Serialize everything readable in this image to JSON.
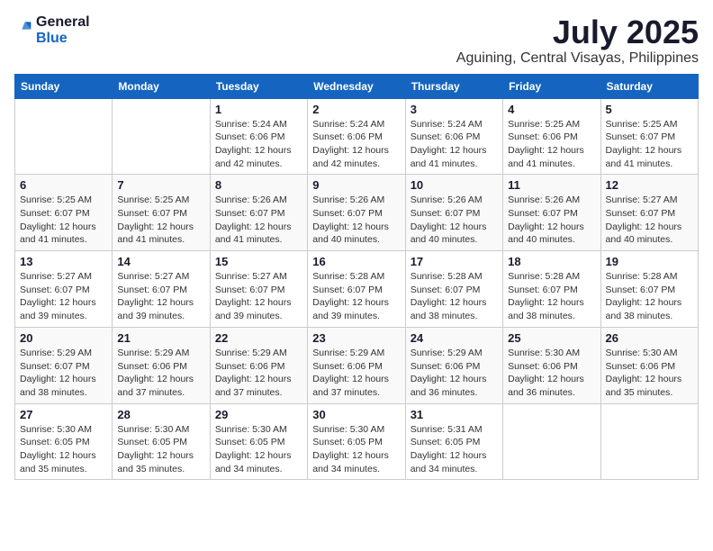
{
  "header": {
    "logo_general": "General",
    "logo_blue": "Blue",
    "month": "July 2025",
    "location": "Aguining, Central Visayas, Philippines"
  },
  "days_of_week": [
    "Sunday",
    "Monday",
    "Tuesday",
    "Wednesday",
    "Thursday",
    "Friday",
    "Saturday"
  ],
  "weeks": [
    [
      {
        "day": "",
        "info": ""
      },
      {
        "day": "",
        "info": ""
      },
      {
        "day": "1",
        "info": "Sunrise: 5:24 AM\nSunset: 6:06 PM\nDaylight: 12 hours and 42 minutes."
      },
      {
        "day": "2",
        "info": "Sunrise: 5:24 AM\nSunset: 6:06 PM\nDaylight: 12 hours and 42 minutes."
      },
      {
        "day": "3",
        "info": "Sunrise: 5:24 AM\nSunset: 6:06 PM\nDaylight: 12 hours and 41 minutes."
      },
      {
        "day": "4",
        "info": "Sunrise: 5:25 AM\nSunset: 6:06 PM\nDaylight: 12 hours and 41 minutes."
      },
      {
        "day": "5",
        "info": "Sunrise: 5:25 AM\nSunset: 6:07 PM\nDaylight: 12 hours and 41 minutes."
      }
    ],
    [
      {
        "day": "6",
        "info": "Sunrise: 5:25 AM\nSunset: 6:07 PM\nDaylight: 12 hours and 41 minutes."
      },
      {
        "day": "7",
        "info": "Sunrise: 5:25 AM\nSunset: 6:07 PM\nDaylight: 12 hours and 41 minutes."
      },
      {
        "day": "8",
        "info": "Sunrise: 5:26 AM\nSunset: 6:07 PM\nDaylight: 12 hours and 41 minutes."
      },
      {
        "day": "9",
        "info": "Sunrise: 5:26 AM\nSunset: 6:07 PM\nDaylight: 12 hours and 40 minutes."
      },
      {
        "day": "10",
        "info": "Sunrise: 5:26 AM\nSunset: 6:07 PM\nDaylight: 12 hours and 40 minutes."
      },
      {
        "day": "11",
        "info": "Sunrise: 5:26 AM\nSunset: 6:07 PM\nDaylight: 12 hours and 40 minutes."
      },
      {
        "day": "12",
        "info": "Sunrise: 5:27 AM\nSunset: 6:07 PM\nDaylight: 12 hours and 40 minutes."
      }
    ],
    [
      {
        "day": "13",
        "info": "Sunrise: 5:27 AM\nSunset: 6:07 PM\nDaylight: 12 hours and 39 minutes."
      },
      {
        "day": "14",
        "info": "Sunrise: 5:27 AM\nSunset: 6:07 PM\nDaylight: 12 hours and 39 minutes."
      },
      {
        "day": "15",
        "info": "Sunrise: 5:27 AM\nSunset: 6:07 PM\nDaylight: 12 hours and 39 minutes."
      },
      {
        "day": "16",
        "info": "Sunrise: 5:28 AM\nSunset: 6:07 PM\nDaylight: 12 hours and 39 minutes."
      },
      {
        "day": "17",
        "info": "Sunrise: 5:28 AM\nSunset: 6:07 PM\nDaylight: 12 hours and 38 minutes."
      },
      {
        "day": "18",
        "info": "Sunrise: 5:28 AM\nSunset: 6:07 PM\nDaylight: 12 hours and 38 minutes."
      },
      {
        "day": "19",
        "info": "Sunrise: 5:28 AM\nSunset: 6:07 PM\nDaylight: 12 hours and 38 minutes."
      }
    ],
    [
      {
        "day": "20",
        "info": "Sunrise: 5:29 AM\nSunset: 6:07 PM\nDaylight: 12 hours and 38 minutes."
      },
      {
        "day": "21",
        "info": "Sunrise: 5:29 AM\nSunset: 6:06 PM\nDaylight: 12 hours and 37 minutes."
      },
      {
        "day": "22",
        "info": "Sunrise: 5:29 AM\nSunset: 6:06 PM\nDaylight: 12 hours and 37 minutes."
      },
      {
        "day": "23",
        "info": "Sunrise: 5:29 AM\nSunset: 6:06 PM\nDaylight: 12 hours and 37 minutes."
      },
      {
        "day": "24",
        "info": "Sunrise: 5:29 AM\nSunset: 6:06 PM\nDaylight: 12 hours and 36 minutes."
      },
      {
        "day": "25",
        "info": "Sunrise: 5:30 AM\nSunset: 6:06 PM\nDaylight: 12 hours and 36 minutes."
      },
      {
        "day": "26",
        "info": "Sunrise: 5:30 AM\nSunset: 6:06 PM\nDaylight: 12 hours and 35 minutes."
      }
    ],
    [
      {
        "day": "27",
        "info": "Sunrise: 5:30 AM\nSunset: 6:05 PM\nDaylight: 12 hours and 35 minutes."
      },
      {
        "day": "28",
        "info": "Sunrise: 5:30 AM\nSunset: 6:05 PM\nDaylight: 12 hours and 35 minutes."
      },
      {
        "day": "29",
        "info": "Sunrise: 5:30 AM\nSunset: 6:05 PM\nDaylight: 12 hours and 34 minutes."
      },
      {
        "day": "30",
        "info": "Sunrise: 5:30 AM\nSunset: 6:05 PM\nDaylight: 12 hours and 34 minutes."
      },
      {
        "day": "31",
        "info": "Sunrise: 5:31 AM\nSunset: 6:05 PM\nDaylight: 12 hours and 34 minutes."
      },
      {
        "day": "",
        "info": ""
      },
      {
        "day": "",
        "info": ""
      }
    ]
  ]
}
